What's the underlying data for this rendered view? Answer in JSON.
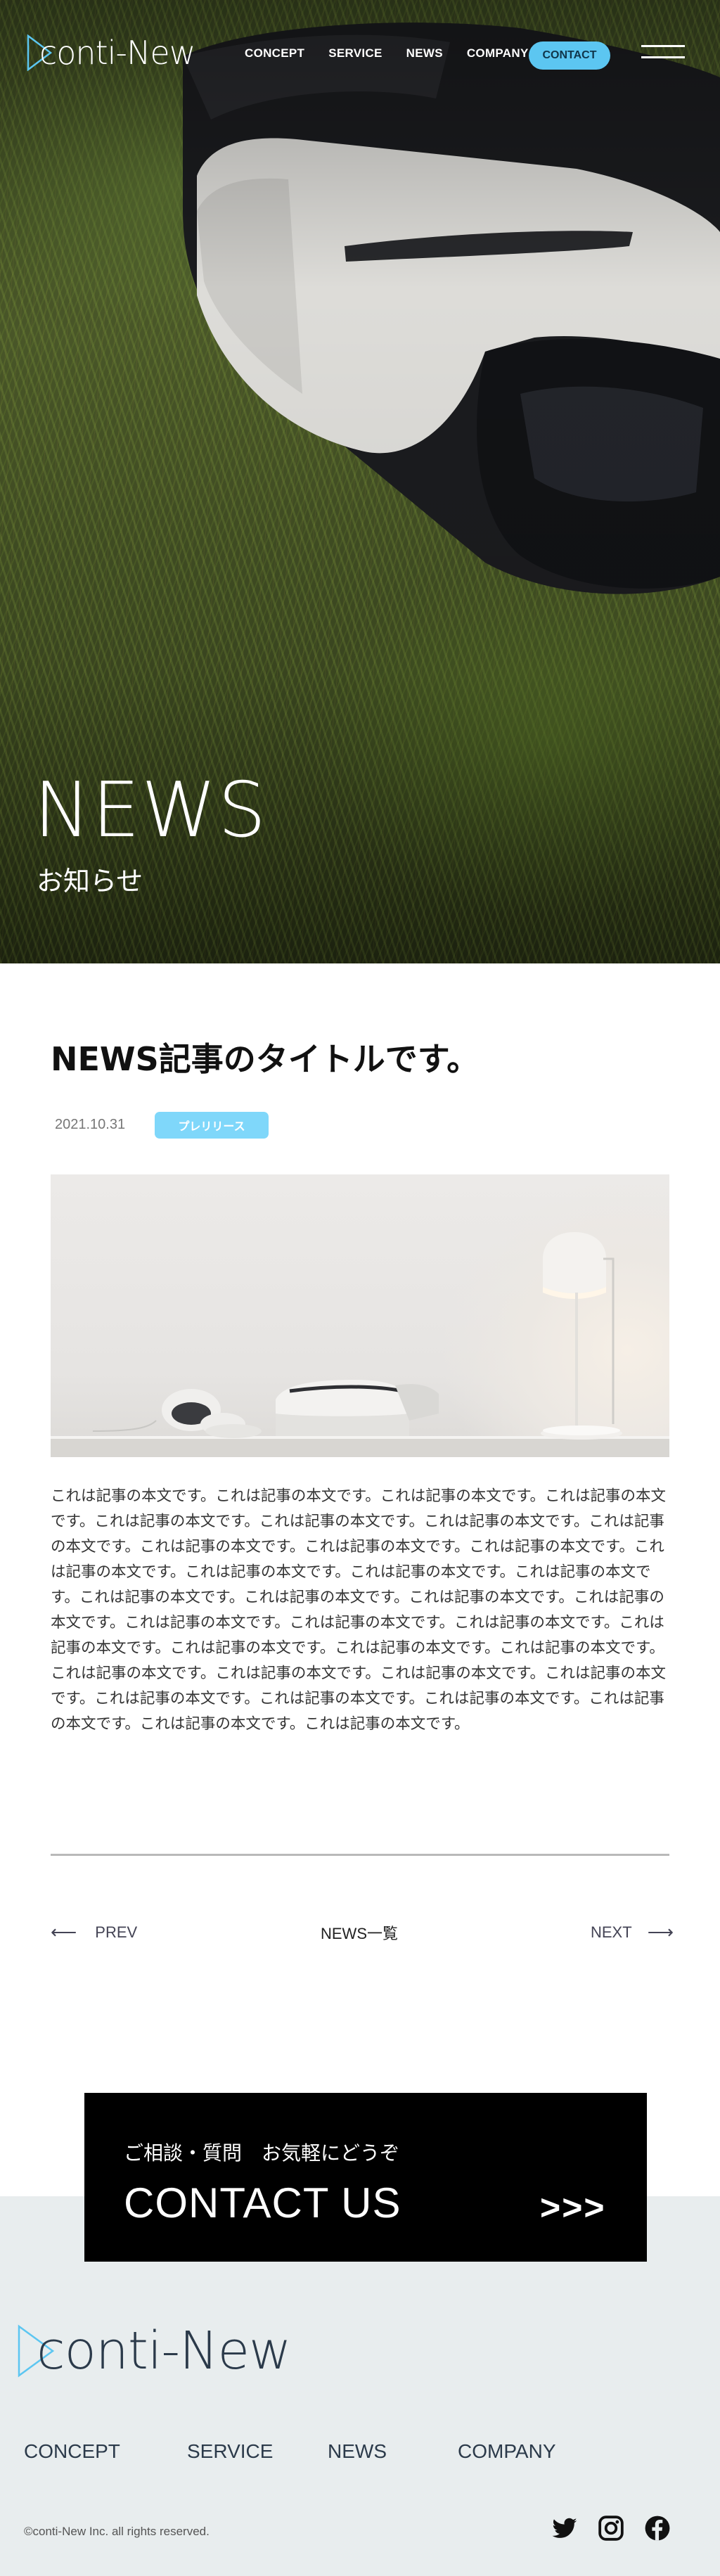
{
  "header": {
    "logo_text": "conti-New",
    "nav": [
      "CONCEPT",
      "SERVICE",
      "NEWS",
      "COMPANY"
    ],
    "contact_label": "CONTACT"
  },
  "hero": {
    "title": "NEWS",
    "subtitle": "お知らせ"
  },
  "article": {
    "title": "NEWS記事のタイトルです。",
    "date": "2021.10.31",
    "category": "プレリリース",
    "body": "これは記事の本文です。これは記事の本文です。これは記事の本文です。これは記事の本文です。これは記事の本文です。これは記事の本文です。これは記事の本文です。これは記事の本文です。これは記事の本文です。これは記事の本文です。これは記事の本文です。これは記事の本文です。これは記事の本文です。これは記事の本文です。これは記事の本文です。これは記事の本文です。これは記事の本文です。これは記事の本文です。これは記事の本文です。これは記事の本文です。これは記事の本文です。これは記事の本文です。これは記事の本文です。これは記事の本文です。これは記事の本文です。これは記事の本文です。これは記事の本文です。これは記事の本文です。これは記事の本文です。これは記事の本文です。これは記事の本文です。これは記事の本文です。これは記事の本文です。これは記事の本文です。これは記事の本文です。これは記事の本文です。"
  },
  "pager": {
    "prev": "PREV",
    "list": "NEWS一覧",
    "next": "NEXT"
  },
  "contact": {
    "subtitle": "ご相談・質問　お気軽にどうぞ",
    "title": "CONTACT US",
    "arrows": ">>>"
  },
  "footer": {
    "logo_text": "conti-New",
    "nav": [
      "CONCEPT",
      "SERVICE",
      "NEWS",
      "COMPANY"
    ],
    "copyright": "©conti-New Inc. all rights reserved.",
    "social": [
      "twitter-icon",
      "instagram-icon",
      "facebook-icon"
    ]
  },
  "colors": {
    "accent": "#5cc6f1",
    "badge": "#7fd7fa",
    "footer_bg": "#e8edee",
    "footer_text": "#2b3a4a"
  }
}
